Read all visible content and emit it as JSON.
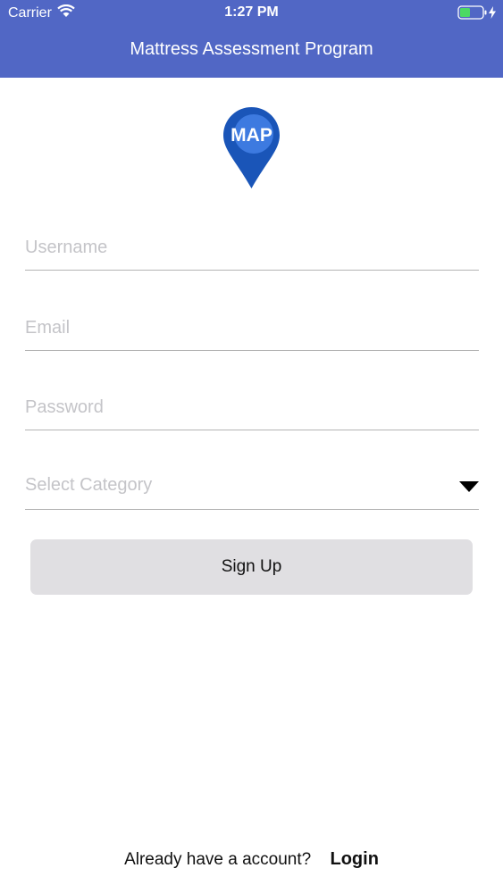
{
  "status_bar": {
    "carrier": "Carrier",
    "time": "1:27 PM",
    "icons": [
      "wifi-icon",
      "battery-icon",
      "charging-bolt-icon"
    ]
  },
  "header": {
    "title": "Mattress Assessment Program",
    "background_color": "#5167c5"
  },
  "logo": {
    "text": "MAP",
    "icon": "map-pin-logo-icon",
    "color": "#1a55b8"
  },
  "form": {
    "username_placeholder": "Username",
    "email_placeholder": "Email",
    "password_placeholder": "Password",
    "category_placeholder": "Select Category",
    "category_icon": "caret-down-icon"
  },
  "signup_button": {
    "label": "Sign Up",
    "background_color": "#e0dfe2"
  },
  "footer": {
    "prompt": "Already have a account?",
    "login_label": "Login"
  }
}
